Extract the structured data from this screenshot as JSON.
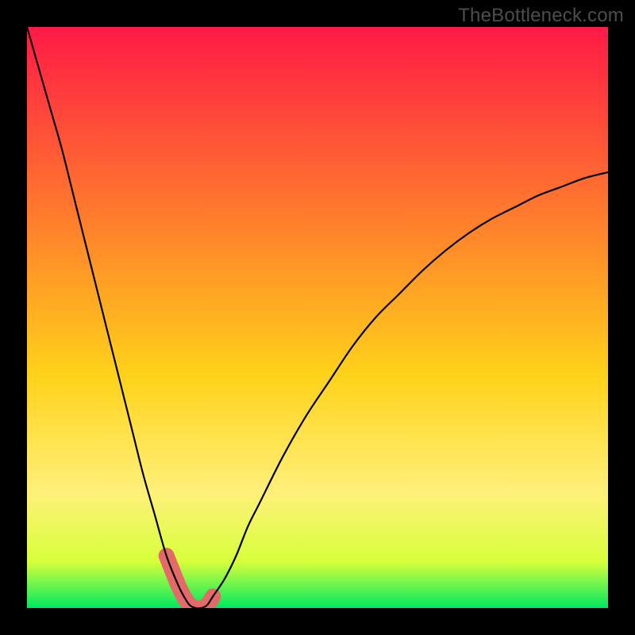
{
  "watermark": "TheBottleneck.com",
  "colors": {
    "frame": "#000000",
    "grad_top": "#ff1a46",
    "grad_upper_mid": "#ff7a2d",
    "grad_mid": "#ffd21a",
    "grad_lower_mid": "#fff07a",
    "grad_yellow_green": "#d8ff3a",
    "grad_green": "#00e860",
    "curve": "#000000",
    "highlight": "#e46a6a"
  },
  "chart_data": {
    "type": "line",
    "title": "",
    "xlabel": "",
    "ylabel": "",
    "xlim": [
      0,
      100
    ],
    "ylim": [
      0,
      100
    ],
    "grid": false,
    "x": [
      0,
      2,
      4,
      6,
      8,
      10,
      12,
      14,
      16,
      18,
      20,
      22,
      24,
      26,
      27,
      28,
      29,
      30,
      31,
      32,
      34,
      36,
      38,
      40,
      44,
      48,
      52,
      56,
      60,
      64,
      68,
      72,
      76,
      80,
      84,
      88,
      92,
      96,
      100
    ],
    "series": [
      {
        "name": "curve",
        "values": [
          100,
          93,
          86,
          79,
          71,
          63,
          55,
          47,
          39,
          31,
          23,
          16,
          9,
          4,
          2,
          0.5,
          0,
          0,
          0.5,
          2,
          5,
          9,
          14,
          18,
          26,
          33,
          39,
          45,
          50,
          54,
          58,
          61.5,
          64.5,
          67,
          69,
          71,
          72.5,
          74,
          75
        ]
      }
    ],
    "highlight_range_x": [
      24,
      33
    ],
    "annotations": []
  }
}
